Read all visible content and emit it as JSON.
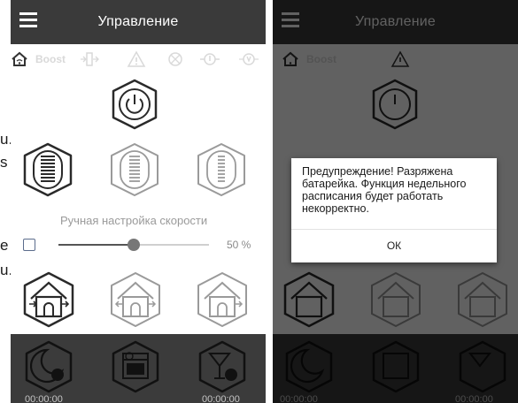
{
  "app": {
    "title": "Управление"
  },
  "status": {
    "boost_label": "Boost"
  },
  "speed": {
    "label": "Ручная настройка скорости",
    "percent_text": "50 %",
    "value_percent": 50
  },
  "timers": {
    "left": "00:00:00",
    "right": "00:00:00"
  },
  "dialog": {
    "message": "Предупреждение! Разряжена батарейка. Функция недельного расписания будет работать некорректно.",
    "ok_label": "ОК"
  },
  "background_text": {
    "line1": "u.",
    "line2": "s",
    "line3": "e",
    "line4": "u."
  },
  "colors": {
    "appbar": "#3a3a3a",
    "bottom_bar": "#3b3b3b",
    "dim_overlay": "rgba(0,0,0,0.62)",
    "disabled_icon": "#d9d9d9"
  }
}
